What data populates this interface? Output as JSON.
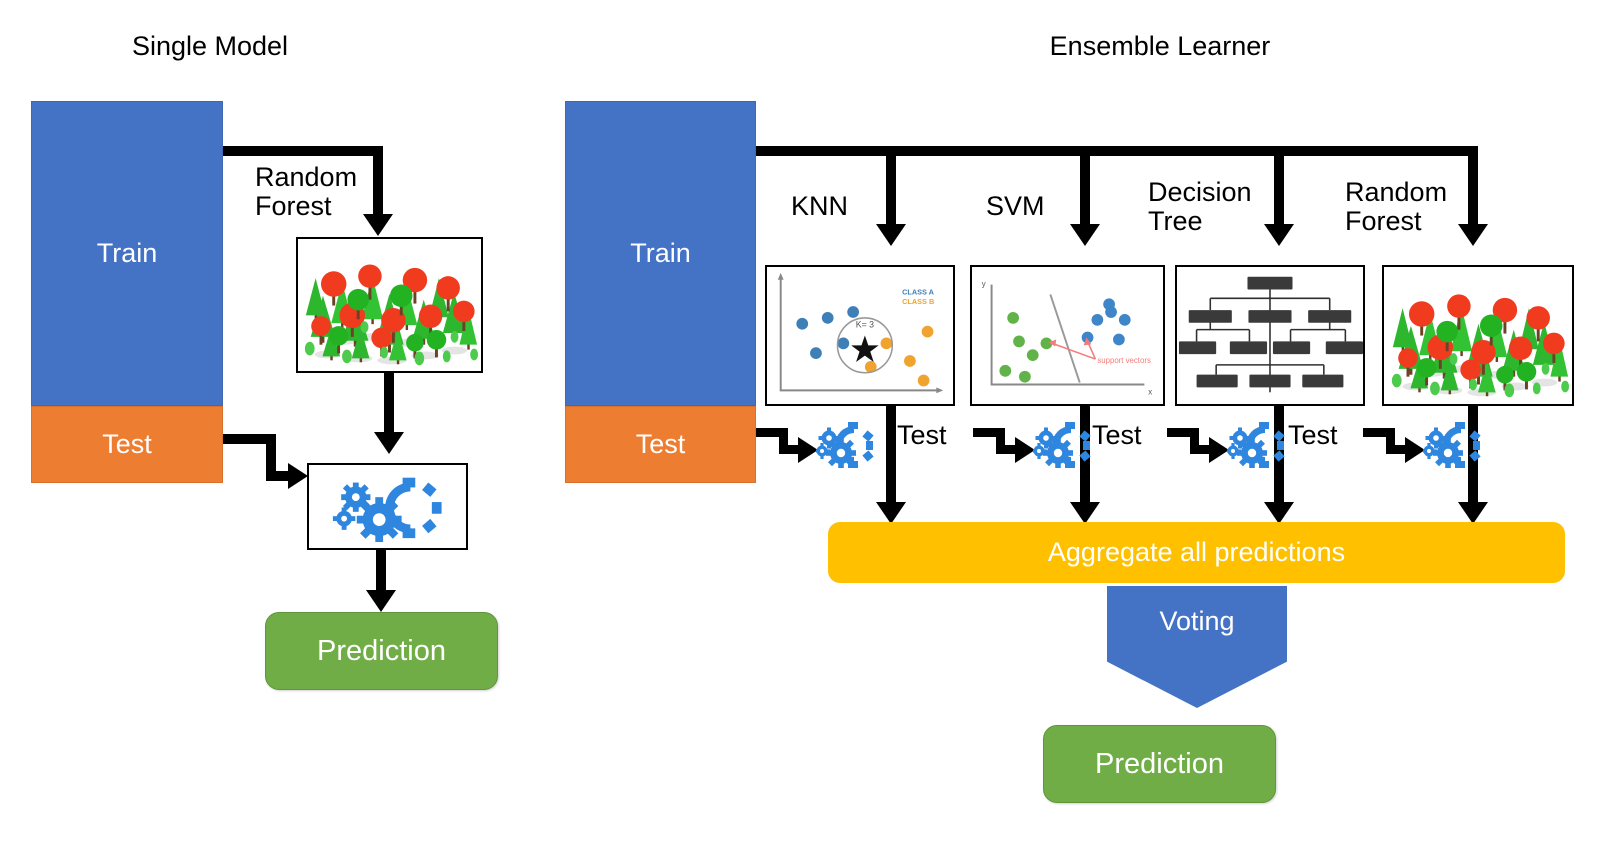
{
  "titles": {
    "left": "Single Model",
    "right": "Ensemble Learner"
  },
  "left_flow": {
    "train_label": "Train",
    "test_label": "Test",
    "model_edge_label": "Random Forest",
    "model_edge_line1": "Random",
    "model_edge_line2": "Forest",
    "model_panel_name": "random-forest-illustration",
    "predict_stage_name": "gears-prediction-engine",
    "prediction_label": "Prediction"
  },
  "right_flow": {
    "train_label": "Train",
    "test_label": "Test",
    "aggregate_label": "Aggregate all predictions",
    "voting_label": "Voting",
    "prediction_label": "Prediction",
    "test_labels": [
      "Test",
      "Test",
      "Test",
      "Test"
    ],
    "models": [
      {
        "id": "knn",
        "label": "KNN",
        "label_line1": "KNN",
        "label_line2": ""
      },
      {
        "id": "svm",
        "label": "SVM",
        "label_line1": "SVM",
        "label_line2": ""
      },
      {
        "id": "decision-tree",
        "label": "Decision Tree",
        "label_line1": "Decision",
        "label_line2": "Tree"
      },
      {
        "id": "random-forest",
        "label": "Random Forest",
        "label_line1": "Random",
        "label_line2": "Forest"
      }
    ]
  },
  "knn_panel": {
    "k_label": "K= 3",
    "legend": [
      "CLASS A",
      "CLASS B"
    ],
    "class_a_color": "#3E7FB8",
    "class_b_color": "#F0A32E"
  },
  "svm_panel": {
    "x_axis_label": "x",
    "y_axis_label": "y",
    "annotation": "support vectors",
    "class_1_color": "#61B349",
    "class_2_color": "#3E86C8",
    "annotation_color": "#F47C7C"
  },
  "colors": {
    "train_blue": "#4472C4",
    "test_orange": "#ED7D31",
    "prediction_green": "#70AD47",
    "aggregate_amber": "#FFC000",
    "voting_blue": "#4472C4",
    "arrow_black": "#000000",
    "gear_blue": "#2E86DE"
  }
}
